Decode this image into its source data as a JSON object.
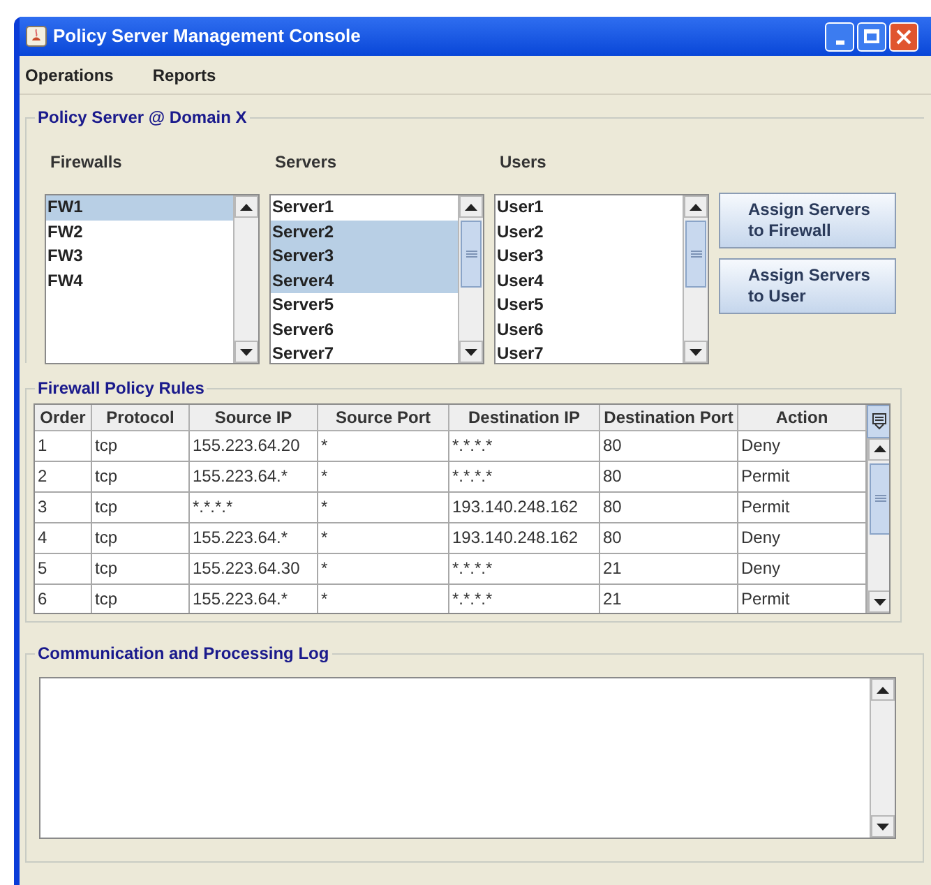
{
  "window": {
    "title": "Policy Server Management Console"
  },
  "menu": [
    "Operations",
    "Reports"
  ],
  "domain_panel": {
    "title": "Policy Server @ Domain X",
    "lists": [
      {
        "label": "Firewalls",
        "items": [
          {
            "label": "FW1",
            "selected": true
          },
          {
            "label": "FW2",
            "selected": false
          },
          {
            "label": "FW3",
            "selected": false
          },
          {
            "label": "FW4",
            "selected": false
          }
        ]
      },
      {
        "label": "Servers",
        "items": [
          {
            "label": "Server1",
            "selected": false
          },
          {
            "label": "Server2",
            "selected": true
          },
          {
            "label": "Server3",
            "selected": true
          },
          {
            "label": "Server4",
            "selected": true
          },
          {
            "label": "Server5",
            "selected": false
          },
          {
            "label": "Server6",
            "selected": false
          },
          {
            "label": "Server7",
            "selected": false
          }
        ]
      },
      {
        "label": "Users",
        "items": [
          {
            "label": "User1",
            "selected": false
          },
          {
            "label": "User2",
            "selected": false
          },
          {
            "label": "User3",
            "selected": false
          },
          {
            "label": "User4",
            "selected": false
          },
          {
            "label": "User5",
            "selected": false
          },
          {
            "label": "User6",
            "selected": false
          },
          {
            "label": "User7",
            "selected": false
          }
        ]
      }
    ],
    "buttons": [
      "Assign Servers to Firewall",
      "Assign Servers to User"
    ]
  },
  "rules_panel": {
    "title": "Firewall Policy Rules",
    "columns": [
      "Order",
      "Protocol",
      "Source IP",
      "Source Port",
      "Destination IP",
      "Destination Port",
      "Action"
    ],
    "rows": [
      [
        "1",
        "tcp",
        "155.223.64.20",
        "*",
        "*.*.*.*",
        "80",
        "Deny"
      ],
      [
        "2",
        "tcp",
        "155.223.64.*",
        "*",
        "*.*.*.*",
        "80",
        "Permit"
      ],
      [
        "3",
        "tcp",
        "*.*.*.*",
        "*",
        "193.140.248.162",
        "80",
        "Permit"
      ],
      [
        "4",
        "tcp",
        "155.223.64.*",
        "*",
        "193.140.248.162",
        "80",
        "Deny"
      ],
      [
        "5",
        "tcp",
        "155.223.64.30",
        "*",
        "*.*.*.*",
        "21",
        "Deny"
      ],
      [
        "6",
        "tcp",
        "155.223.64.*",
        "*",
        "*.*.*.*",
        "21",
        "Permit"
      ]
    ]
  },
  "log_panel": {
    "title": "Communication and Processing Log"
  }
}
